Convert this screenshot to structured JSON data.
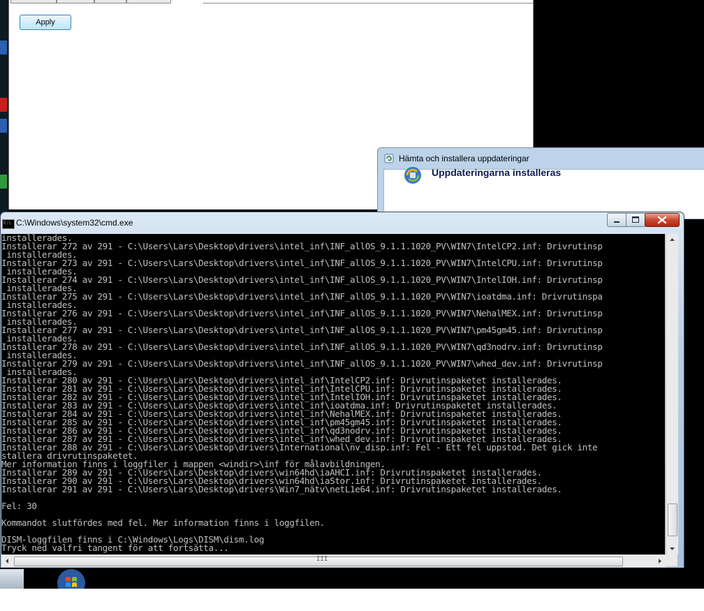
{
  "top_window": {
    "apply_label": "Apply"
  },
  "update_dialog": {
    "title": "Hämta och installera uppdateringar",
    "heading": "Uppdateringarna installeras"
  },
  "cmd": {
    "title": "C:\\Windows\\system32\\cmd.exe",
    "icon_label": "C:\\",
    "lines": [
      "installerades.",
      "Installerar 272 av 291 - C:\\Users\\Lars\\Desktop\\drivers\\intel_inf\\INF_allOS_9.1.1.1020_PV\\WIN7\\IntelCP2.inf: Drivrutinsp",
      " installerades.",
      "Installerar 273 av 291 - C:\\Users\\Lars\\Desktop\\drivers\\intel_inf\\INF_allOS_9.1.1.1020_PV\\WIN7\\IntelCPU.inf: Drivrutinsp",
      " installerades.",
      "Installerar 274 av 291 - C:\\Users\\Lars\\Desktop\\drivers\\intel_inf\\INF_allOS_9.1.1.1020_PV\\WIN7\\IntelIOH.inf: Drivrutinsp",
      " installerades.",
      "Installerar 275 av 291 - C:\\Users\\Lars\\Desktop\\drivers\\intel_inf\\INF_allOS_9.1.1.1020_PV\\WIN7\\ioatdma.inf: Drivrutinspa",
      " installerades.",
      "Installerar 276 av 291 - C:\\Users\\Lars\\Desktop\\drivers\\intel_inf\\INF_allOS_9.1.1.1020_PV\\WIN7\\NehalMEX.inf: Drivrutinsp",
      " installerades.",
      "Installerar 277 av 291 - C:\\Users\\Lars\\Desktop\\drivers\\intel_inf\\INF_allOS_9.1.1.1020_PV\\WIN7\\pm45gm45.inf: Drivrutinsp",
      " installerades.",
      "Installerar 278 av 291 - C:\\Users\\Lars\\Desktop\\drivers\\intel_inf\\INF_allOS_9.1.1.1020_PV\\WIN7\\qd3nodrv.inf: Drivrutinsp",
      " installerades.",
      "Installerar 279 av 291 - C:\\Users\\Lars\\Desktop\\drivers\\intel_inf\\INF_allOS_9.1.1.1020_PV\\WIN7\\whed_dev.inf: Drivrutinsp",
      " installerades.",
      "Installerar 280 av 291 - C:\\Users\\Lars\\Desktop\\drivers\\intel_inf\\IntelCP2.inf: Drivrutinspaketet installerades.",
      "Installerar 281 av 291 - C:\\Users\\Lars\\Desktop\\drivers\\intel_inf\\IntelCPU.inf: Drivrutinspaketet installerades.",
      "Installerar 282 av 291 - C:\\Users\\Lars\\Desktop\\drivers\\intel_inf\\IntelIOH.inf: Drivrutinspaketet installerades.",
      "Installerar 283 av 291 - C:\\Users\\Lars\\Desktop\\drivers\\intel_inf\\ioatdma.inf: Drivrutinspaketet installerades.",
      "Installerar 284 av 291 - C:\\Users\\Lars\\Desktop\\drivers\\intel_inf\\NehalMEX.inf: Drivrutinspaketet installerades.",
      "Installerar 285 av 291 - C:\\Users\\Lars\\Desktop\\drivers\\intel_inf\\pm45gm45.inf: Drivrutinspaketet installerades.",
      "Installerar 286 av 291 - C:\\Users\\Lars\\Desktop\\drivers\\intel_inf\\qd3nodrv.inf: Drivrutinspaketet installerades.",
      "Installerar 287 av 291 - C:\\Users\\Lars\\Desktop\\drivers\\intel_inf\\whed_dev.inf: Drivrutinspaketet installerades.",
      "Installerar 288 av 291 - C:\\Users\\Lars\\Desktop\\drivers\\International\\nv_disp.inf: Fel - Ett fel uppstod. Det gick inte",
      "stallera drivrutinspaketet.",
      "Mer information finns i loggfiler i mappen <windir>\\inf för målavbildningen.",
      "Installerar 289 av 291 - C:\\Users\\Lars\\Desktop\\drivers\\win64hd\\iaAHCI.inf: Drivrutinspaketet installerades.",
      "Installerar 290 av 291 - C:\\Users\\Lars\\Desktop\\drivers\\win64hd\\iaStor.inf: Drivrutinspaketet installerades.",
      "Installerar 291 av 291 - C:\\Users\\Lars\\Desktop\\drivers\\Win7_nätv\\netL1e64.inf: Drivrutinspaketet installerades.",
      "",
      "Fel: 30",
      "",
      "Kommandot slutfördes med fel. Mer information finns i loggfilen.",
      "",
      "DISM-loggfilen finns i C:\\Windows\\Logs\\DISM\\dism.log",
      "Tryck ned valfri tangent för att fortsätta..."
    ],
    "hscroll_grip": "III"
  },
  "icons": {
    "update_title_icon": "windows-update-icon",
    "update_heading_icon": "windows-update-shield-icon",
    "cmd_icon": "cmd-icon",
    "minimize": "minimize-icon",
    "maximize": "maximize-icon",
    "close": "close-icon",
    "start": "windows-start-orb-icon"
  },
  "colors": {
    "console_bg": "#000000",
    "console_fg": "#c0c0c0",
    "close_red": "#c8472f",
    "heading_blue": "#0b1a50"
  }
}
